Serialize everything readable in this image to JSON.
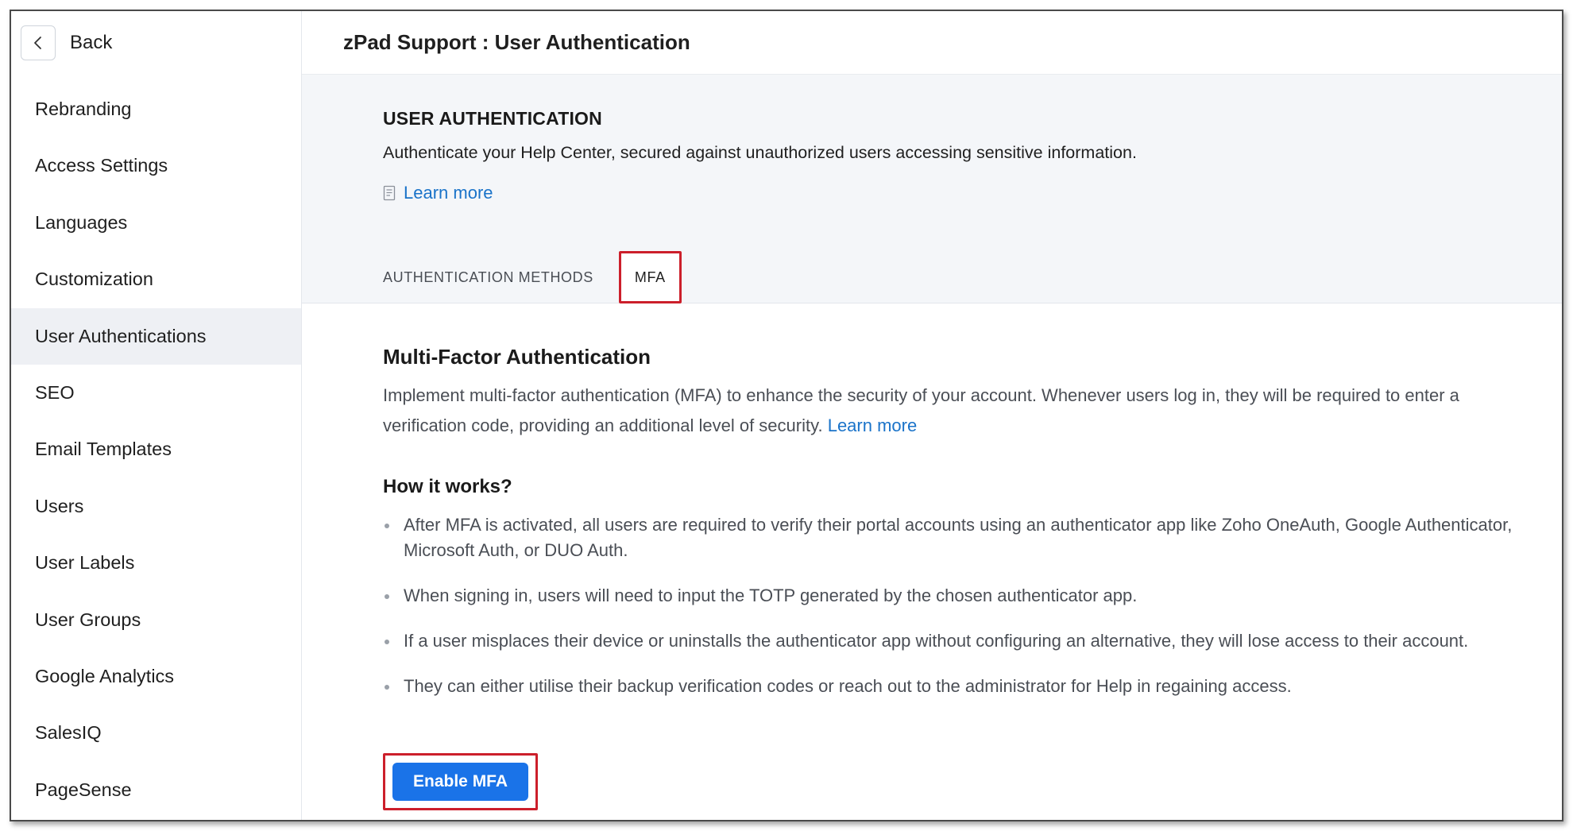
{
  "sidebar": {
    "back_label": "Back",
    "items": [
      {
        "label": "Rebranding",
        "active": false
      },
      {
        "label": "Access Settings",
        "active": false
      },
      {
        "label": "Languages",
        "active": false
      },
      {
        "label": "Customization",
        "active": false
      },
      {
        "label": "User Authentications",
        "active": true
      },
      {
        "label": "SEO",
        "active": false
      },
      {
        "label": "Email Templates",
        "active": false
      },
      {
        "label": "Users",
        "active": false
      },
      {
        "label": "User Labels",
        "active": false
      },
      {
        "label": "User Groups",
        "active": false
      },
      {
        "label": "Google Analytics",
        "active": false
      },
      {
        "label": "SalesIQ",
        "active": false
      },
      {
        "label": "PageSense",
        "active": false
      }
    ]
  },
  "header": {
    "title": "zPad Support : User Authentication"
  },
  "section": {
    "heading": "USER AUTHENTICATION",
    "description": "Authenticate your Help Center, secured against unauthorized users accessing sensitive information.",
    "learn_more": "Learn more",
    "tabs": [
      {
        "label": "AUTHENTICATION METHODS",
        "active": false
      },
      {
        "label": "MFA",
        "active": true
      }
    ]
  },
  "mfa": {
    "title": "Multi-Factor Authentication",
    "description": "Implement multi-factor authentication (MFA) to enhance the security of your account. Whenever users log in, they will be required to enter a verification code, providing an additional level of security.",
    "learn_more": "Learn more",
    "how_title": "How it works?",
    "bullets": [
      "After MFA is activated, all users are required to verify their portal accounts using an authenticator app like Zoho OneAuth, Google Authenticator, Microsoft Auth, or DUO Auth.",
      "When signing in, users will need to input the TOTP generated by the chosen authenticator app.",
      "If a user misplaces their device or uninstalls the authenticator app without configuring an alternative, they will lose access to their account.",
      "They can either utilise their backup verification codes or reach out to the administrator for Help in regaining access."
    ],
    "enable_button": "Enable MFA"
  },
  "colors": {
    "accent": "#1a73e8",
    "link": "#1a73c9",
    "highlight_border": "#cc1f2b",
    "sidebar_active_bg": "#eef0f4",
    "header_panel_bg": "#f4f6f9"
  },
  "icons": {
    "back": "chevron-left-icon",
    "learn_more": "document-icon"
  }
}
